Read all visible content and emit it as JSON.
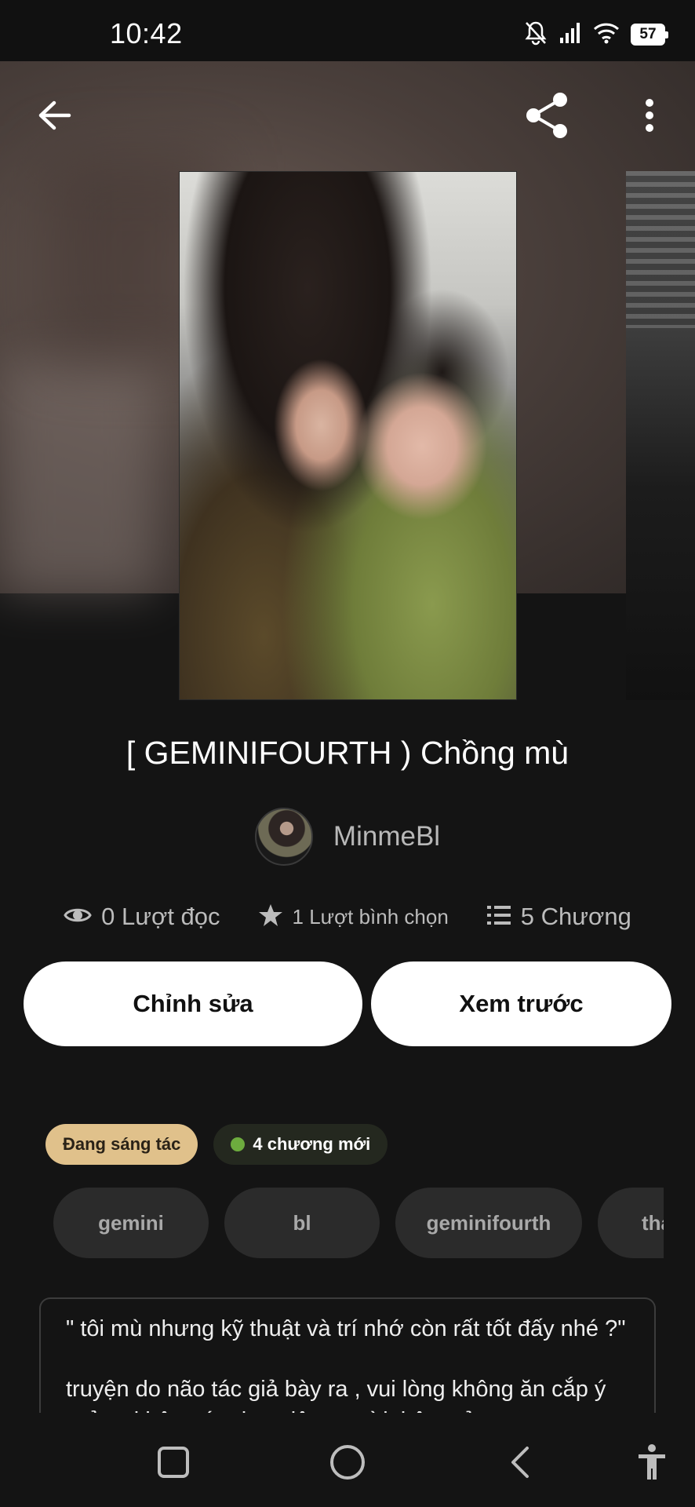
{
  "status_bar": {
    "time": "10:42",
    "battery": "57",
    "icons": [
      "bell-muted-icon",
      "signal-icon",
      "wifi-icon",
      "battery-icon"
    ]
  },
  "top_bar": {
    "icons": [
      "back-arrow-icon",
      "share-icon",
      "more-vertical-icon"
    ]
  },
  "story": {
    "title": "[ GEMINIFOURTH ) Chồng mù",
    "author": "MinmeBl"
  },
  "stats": {
    "reads": "0 Lượt đọc",
    "votes": "1 Lượt bình chọn",
    "chapters": "5 Chương"
  },
  "actions": {
    "edit_label": "Chỉnh sửa",
    "preview_label": "Xem trước"
  },
  "badges": {
    "status": "Đang sáng tác",
    "new_chapters": "4 chương mới"
  },
  "tags": [
    "gemini",
    "bl",
    "geminifourth",
    "thai"
  ],
  "description": {
    "line1": "\" tôi mù nhưng kỹ thuật và trí nhớ còn rất tốt đấy nhé ?\"",
    "line2": "truyện do não tác giả bày ra , vui lòng không ăn cắp ý tưởng không áp dụng lên người thật , cảm ơn"
  },
  "nav_bar": {
    "icons": [
      "recent-apps-icon",
      "home-icon",
      "back-icon",
      "accessibility-icon"
    ]
  },
  "colors": {
    "background": "#141414",
    "status_badge": "#e0c18b",
    "new_dot": "#6dab3e",
    "tag_bg": "#2b2b2b"
  }
}
